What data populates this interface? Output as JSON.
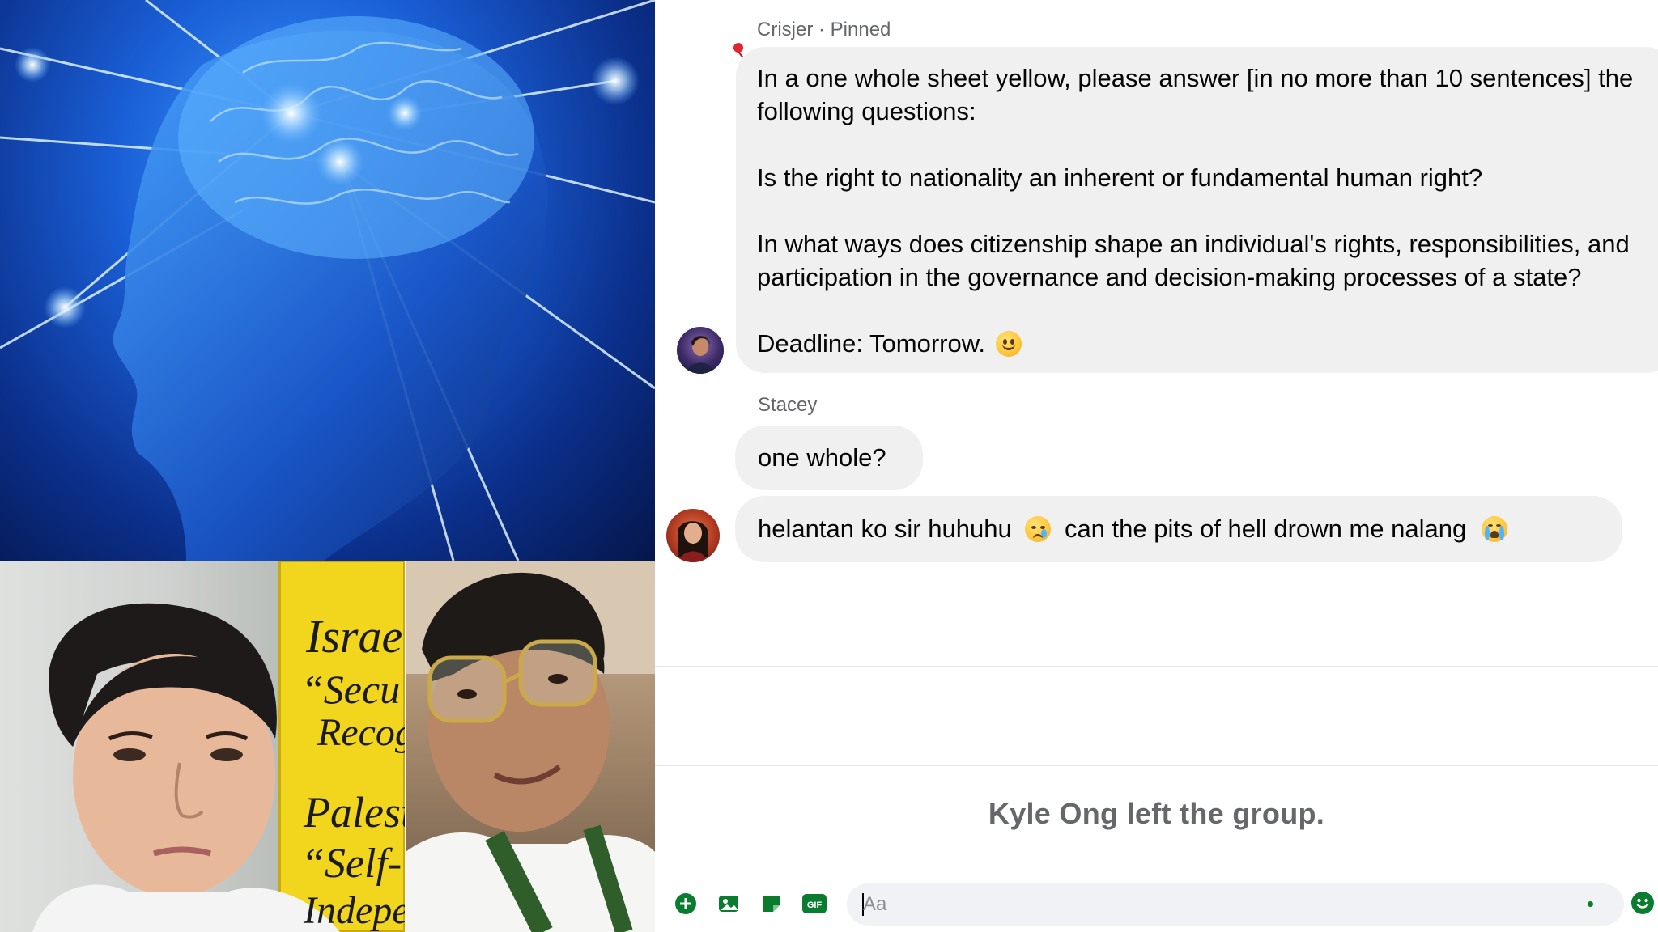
{
  "chat": {
    "messages": {
      "pinned": {
        "sender_label": "Crisjer · Pinned",
        "lines": [
          "In a one whole sheet yellow, please answer [in no more than 10 sentences] the",
          "following questions:",
          "",
          "Is the right to nationality an inherent or fundamental human right?",
          "",
          "In what ways does citizenship shape an individual's rights, responsibilities, and",
          "participation in the governance and decision-making processes of a state?",
          "",
          "Deadline: Tomorrow."
        ],
        "emoji": "slightly-smiling-face"
      },
      "stacey": {
        "sender_label": "Stacey",
        "bubble1": "one whole?",
        "bubble2_part1": "helantan ko sir huhuhu",
        "bubble2_emoji1": "crying-face",
        "bubble2_part2": "can the pits of hell drown me nalang",
        "bubble2_emoji2": "loudly-crying-face"
      }
    },
    "system_message": "Kyle Ong left the group.",
    "composer": {
      "placeholder": "Aa",
      "icons": [
        "plus-circle-icon",
        "image-icon",
        "sticker-icon",
        "gif-icon",
        "emoji-icon"
      ],
      "gif_label": "GIF"
    }
  },
  "collage": {
    "sign_lines": [
      "Israe",
      "“Secu",
      "Recog",
      "Palesti",
      "“Self-",
      "Indepe"
    ]
  },
  "colors": {
    "bubble": "#f0f0f0",
    "accent_green": "#0a7c2f",
    "muted_text": "#65676b",
    "pin_red": "#e4252f"
  }
}
